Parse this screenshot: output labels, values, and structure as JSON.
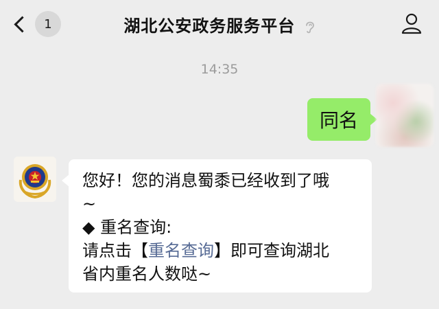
{
  "header": {
    "back_count": "1",
    "title": "湖北公安政务服务平台"
  },
  "chat": {
    "timestamp": "14:35",
    "sent_message": "同名",
    "reply": {
      "line1": "您好！您的消息蜀黍已经收到了哦",
      "line2": "~",
      "line3_bullet": "◆",
      "line3_text": " 重名查询:",
      "line4_prefix": "请点击【",
      "line4_link": "重名查询",
      "line4_suffix": "】即可查询湖北",
      "line5": "省内重名人数哒~"
    }
  },
  "colors": {
    "sent_bubble": "#95ec69",
    "link": "#576b95",
    "background": "#ededed"
  },
  "icons": {
    "back": "chevron-left-icon",
    "listen": "ear-icon",
    "profile": "person-icon",
    "bot_avatar": "police-emblem-icon"
  }
}
